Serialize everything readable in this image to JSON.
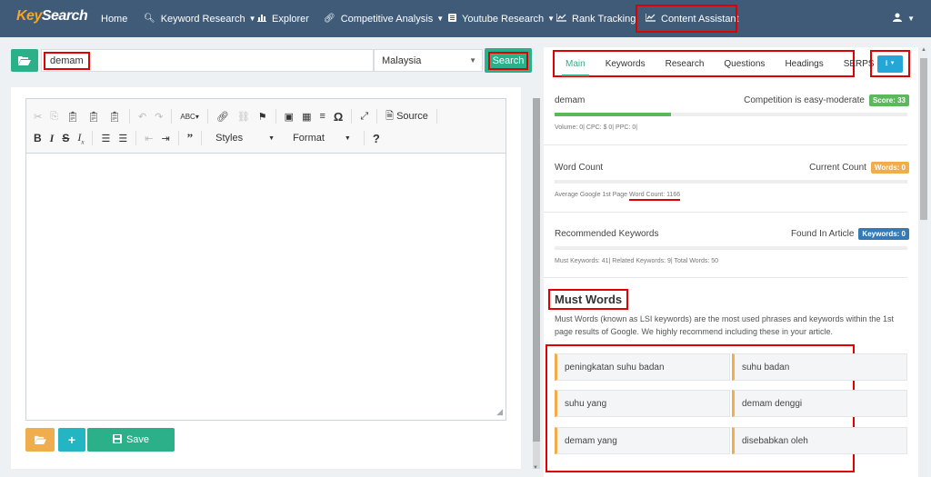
{
  "navbar": {
    "logo_part1": "Key",
    "logo_part2": "Search",
    "items": [
      {
        "label": "Home",
        "icon": ""
      },
      {
        "label": "Keyword Research",
        "icon": "search-icon"
      },
      {
        "label": "Explorer",
        "icon": "bar-chart-icon"
      },
      {
        "label": "Competitive Analysis",
        "icon": "link-icon"
      },
      {
        "label": "Youtube Research",
        "icon": "list-icon"
      },
      {
        "label": "Rank Tracking",
        "icon": "line-chart-icon"
      },
      {
        "label": "Content Assistant",
        "icon": "line-chart-icon"
      }
    ],
    "user_icon": "user-icon"
  },
  "search": {
    "keyword": "demam",
    "country": "Malaysia",
    "button": "Search"
  },
  "editor": {
    "source_label": "Source",
    "styles_label": "Styles",
    "format_label": "Format",
    "save_label": "Save"
  },
  "tabs": [
    {
      "label": "Main"
    },
    {
      "label": "Keywords"
    },
    {
      "label": "Research"
    },
    {
      "label": "Questions"
    },
    {
      "label": "Headings"
    },
    {
      "label": "SERPS"
    }
  ],
  "main": {
    "keyword": {
      "label": "demam",
      "competition": "Competition is easy-moderate",
      "score": "Score: 33",
      "score_color": "#5cb85c",
      "bar_fill_pct": 33,
      "meta": "Volume: 0| CPC: $ 0| PPC: 0|"
    },
    "word_count": {
      "label": "Word Count",
      "current_label": "Current Count",
      "badge": "Words: 0",
      "badge_color": "#f0ad4e",
      "meta_prefix": "Average Google 1st Page ",
      "meta_highlight": "Word Count: 1166"
    },
    "recommended": {
      "label": "Recommended Keywords",
      "found_label": "Found In Article",
      "badge": "Keywords: 0",
      "badge_color": "#337ab7",
      "meta": "Must Keywords: 41| Related Keywords: 9| Total Words: 50"
    },
    "must_words": {
      "title": "Must Words",
      "description": "Must Words (known as LSI keywords) are the most used phrases and keywords within the 1st page results of Google. We highly recommend including these in your article.",
      "items": [
        "peningkatan suhu badan",
        "suhu badan",
        "suhu yang",
        "demam denggi",
        "demam yang",
        "disebabkan oleh"
      ]
    }
  }
}
